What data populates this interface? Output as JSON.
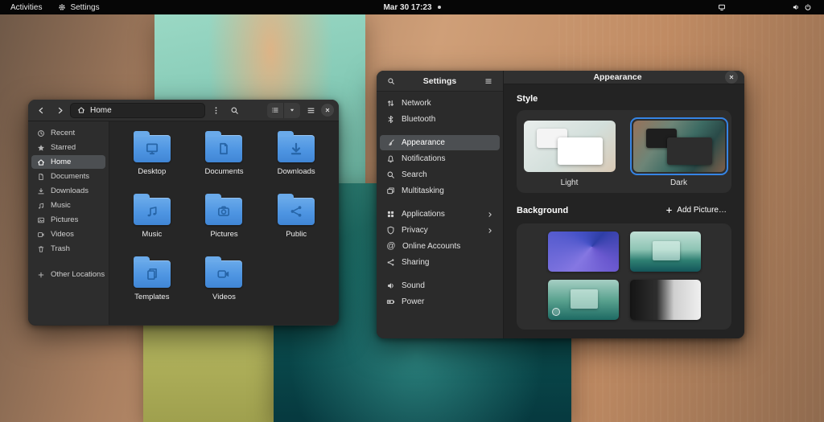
{
  "top_bar": {
    "activities_label": "Activities",
    "app_menu_label": "Settings",
    "clock": "Mar 30 17:23"
  },
  "files_window": {
    "path_label": "Home",
    "sidebar_items": [
      {
        "label": "Recent",
        "icon": "clock-icon"
      },
      {
        "label": "Starred",
        "icon": "star-icon"
      },
      {
        "label": "Home",
        "icon": "home-icon",
        "selected": true
      },
      {
        "label": "Documents",
        "icon": "document-icon"
      },
      {
        "label": "Downloads",
        "icon": "download-icon"
      },
      {
        "label": "Music",
        "icon": "music-note-icon"
      },
      {
        "label": "Pictures",
        "icon": "photo-icon"
      },
      {
        "label": "Videos",
        "icon": "video-icon"
      },
      {
        "label": "Trash",
        "icon": "trash-icon"
      },
      {
        "label": "Other Locations",
        "icon": "plus-icon"
      }
    ],
    "folders": [
      {
        "name": "Desktop",
        "emblem": "monitor-icon"
      },
      {
        "name": "Documents",
        "emblem": "document-icon"
      },
      {
        "name": "Downloads",
        "emblem": "arrow-down-icon"
      },
      {
        "name": "Music",
        "emblem": "music-note-icon"
      },
      {
        "name": "Pictures",
        "emblem": "camera-icon"
      },
      {
        "name": "Public",
        "emblem": "share-icon"
      },
      {
        "name": "Templates",
        "emblem": "templates-icon"
      },
      {
        "name": "Videos",
        "emblem": "video-camera-icon"
      }
    ]
  },
  "settings_window": {
    "sidebar_title": "Settings",
    "sidebar_items": [
      {
        "label": "Network",
        "icon": "network-icon"
      },
      {
        "label": "Bluetooth",
        "icon": "bluetooth-icon"
      },
      {
        "label": "Appearance",
        "icon": "appearance-icon",
        "selected": true
      },
      {
        "label": "Notifications",
        "icon": "bell-icon"
      },
      {
        "label": "Search",
        "icon": "search-icon"
      },
      {
        "label": "Multitasking",
        "icon": "multitasking-icon"
      },
      {
        "label": "Applications",
        "icon": "apps-grid-icon",
        "has_chevron": true
      },
      {
        "label": "Privacy",
        "icon": "shield-icon",
        "has_chevron": true
      },
      {
        "label": "Online Accounts",
        "icon": "at-icon"
      },
      {
        "label": "Sharing",
        "icon": "share-icon"
      },
      {
        "label": "Sound",
        "icon": "speaker-icon"
      },
      {
        "label": "Power",
        "icon": "battery-icon"
      }
    ],
    "page_title": "Appearance",
    "style_section": {
      "label": "Style",
      "options": [
        {
          "label": "Light"
        },
        {
          "label": "Dark",
          "selected": true
        }
      ]
    },
    "background_section": {
      "label": "Background",
      "add_button_label": "Add Picture…",
      "wallpapers": [
        "purple-geometric",
        "teal-landscape-light",
        "teal-landscape",
        "black-white-photo"
      ]
    }
  },
  "colors": {
    "accent": "#3584e4",
    "folder_blue": "#4e95e2",
    "selection_gray": "#4c4f52"
  }
}
